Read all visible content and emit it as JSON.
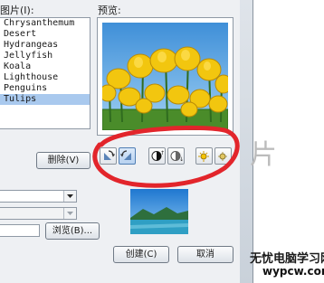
{
  "dialog": {
    "list_label": "图片(I):",
    "preview_label": "预览:",
    "list_items": [
      "Chrysanthemum",
      "Desert",
      "Hydrangeas",
      "Jellyfish",
      "Koala",
      "Lighthouse",
      "Penguins",
      "Tulips"
    ],
    "selected_item": "Tulips",
    "delete_button": "删除(V)",
    "browse_button": "浏览(B)...",
    "create_button": "创建(C)",
    "cancel_button": "取消",
    "toolbar_icons": [
      "rotate-left-icon",
      "rotate-right-icon",
      "contrast-more-icon",
      "contrast-less-icon",
      "brightness-more-icon",
      "brightness-less-icon"
    ],
    "active_icon": "rotate-right-icon"
  },
  "background_text": "片",
  "watermark": {
    "site_name": "无忧电脑学习网",
    "url": "wypcw.com"
  },
  "colors": {
    "annotation_red": "#e2252b",
    "selection": "#a9c9ee"
  }
}
